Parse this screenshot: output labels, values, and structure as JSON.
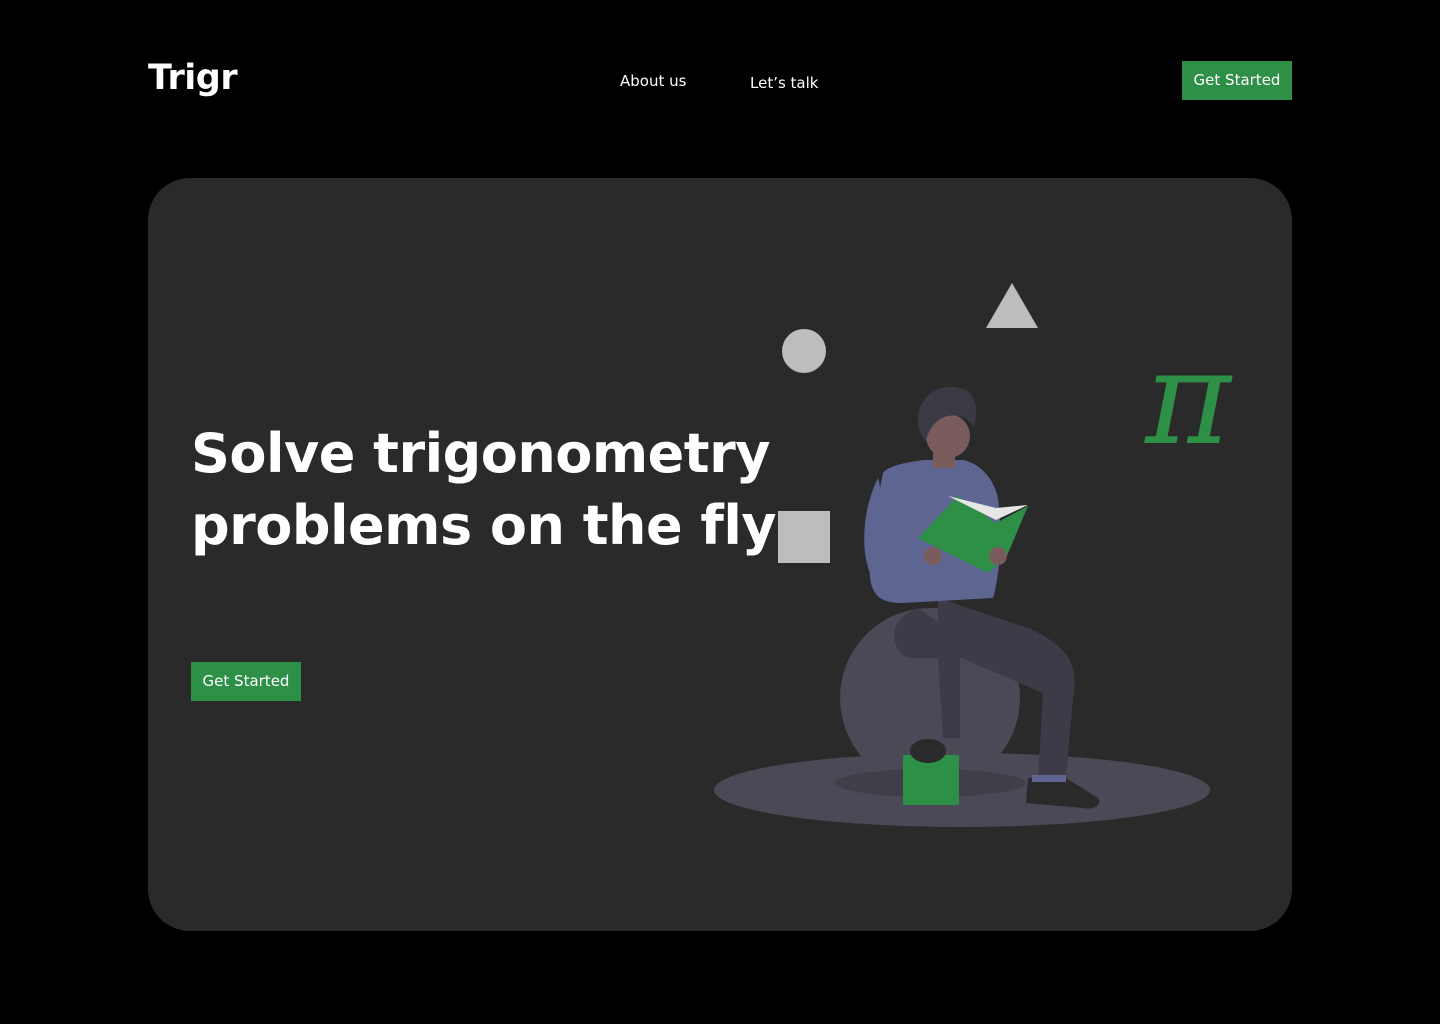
{
  "header": {
    "logo": "Trigr",
    "nav": [
      {
        "label": "About us"
      },
      {
        "label": "Let’s talk"
      }
    ],
    "cta_label": "Get Started"
  },
  "hero": {
    "title": "Solve trigonometry problems on the fly",
    "cta_label": "Get Started",
    "pi_symbol": "π"
  },
  "colors": {
    "background": "#000000",
    "card": "#2a2a2a",
    "accent": "#2e8f47",
    "shape_gray": "#bdbdbd",
    "figure_slate": "#5d6590",
    "floor_shadow": "#4a4955"
  },
  "icons": [
    "circle-shape",
    "triangle-shape",
    "square-shape",
    "pi-symbol",
    "person-reading-illustration"
  ]
}
